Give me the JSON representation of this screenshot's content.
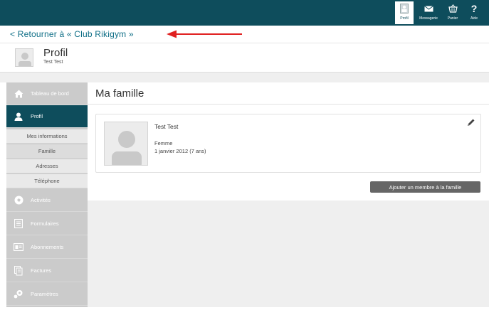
{
  "topnav": {
    "items": [
      {
        "label": "Profil",
        "icon": "person-card-icon"
      },
      {
        "label": "Messagerie",
        "icon": "envelope-icon"
      },
      {
        "label": "Panier",
        "icon": "basket-icon"
      },
      {
        "label": "Aide",
        "icon": "question-icon"
      }
    ]
  },
  "back": {
    "label": "Retourner à « Club Rikigym »"
  },
  "profile": {
    "title": "Profil",
    "name": "Test Test"
  },
  "sidebar": {
    "items": [
      {
        "label": "Tableau de bord",
        "icon": "home-icon"
      },
      {
        "label": "Profil",
        "icon": "person-icon"
      },
      {
        "label": "Activités",
        "icon": "soccer-ball-icon"
      },
      {
        "label": "Formulaires",
        "icon": "form-icon"
      },
      {
        "label": "Abonnements",
        "icon": "id-card-icon"
      },
      {
        "label": "Factures",
        "icon": "invoice-icon"
      },
      {
        "label": "Paramètres",
        "icon": "settings-icon"
      }
    ],
    "subitems": [
      {
        "label": "Mes informations"
      },
      {
        "label": "Famille"
      },
      {
        "label": "Adresses"
      },
      {
        "label": "Téléphone"
      }
    ]
  },
  "main": {
    "title": "Ma famille",
    "member": {
      "name": "Test Test",
      "gender": "Femme",
      "dob": "1 janvier 2012 (7 ans)"
    },
    "add_button": "Ajouter un membre à la famille"
  },
  "colors": {
    "primary": "#0e4d5c",
    "link": "#0e6e86",
    "annotation_arrow": "#e02020",
    "sidebar_bg": "#cbcbcb",
    "button_bg": "#666666"
  }
}
